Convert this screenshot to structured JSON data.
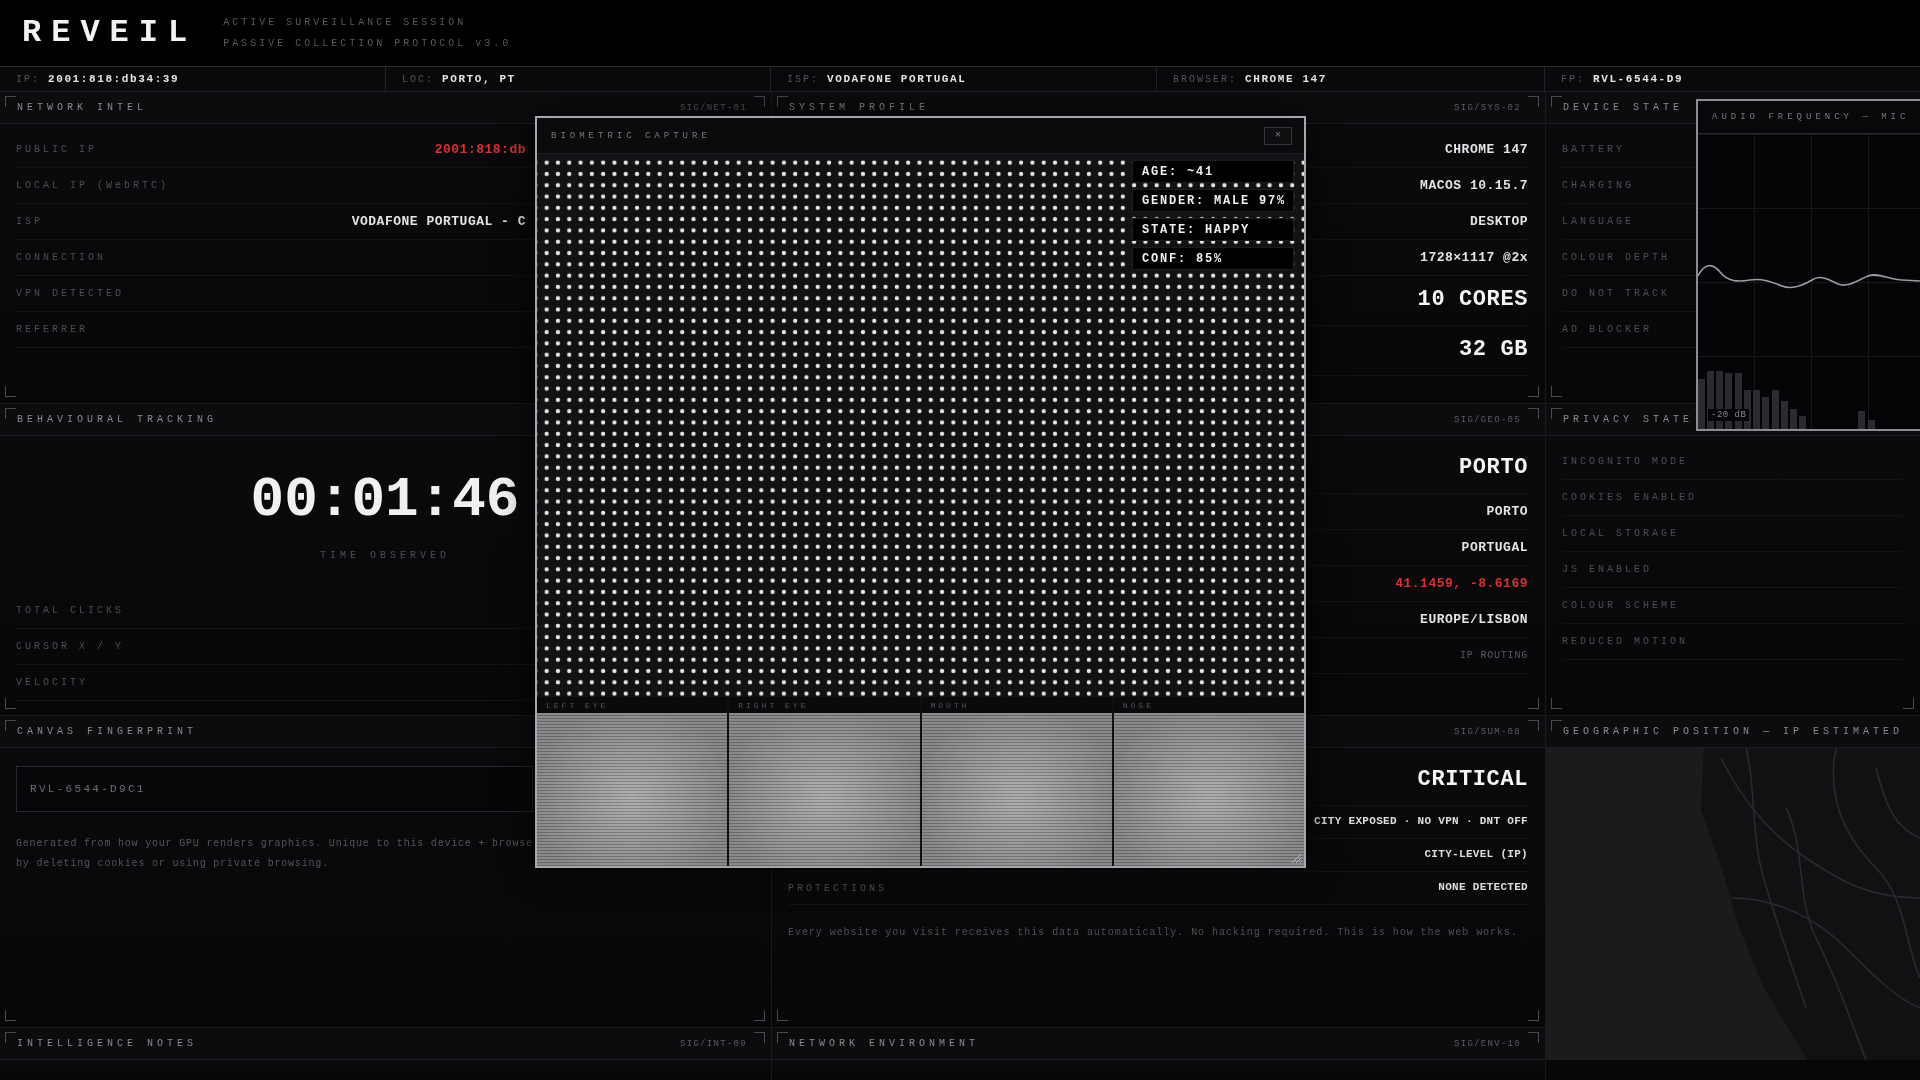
{
  "header": {
    "logo": "REVEIL",
    "subtitle_lines": [
      "ACTIVE SURVEILLANCE SESSION",
      "PASSIVE COLLECTION PROTOCOL v3.0"
    ]
  },
  "info_bar": [
    {
      "label": "IP:",
      "value": "2001:818:db34:39"
    },
    {
      "label": "LOC:",
      "value": "PORTO, PT"
    },
    {
      "label": "ISP:",
      "value": "VODAFONE PORTUGAL"
    },
    {
      "label": "BROWSER:",
      "value": "CHROME 147"
    },
    {
      "label": "FP:",
      "value": "RVL-6544-D9"
    }
  ],
  "panels": [
    {
      "kind": "rows",
      "title": "NETWORK INTEL",
      "code": "SIG/NET-01",
      "rows": [
        {
          "kind": "alert",
          "label": "PUBLIC IP",
          "value": "2001:818:db"
        },
        {
          "kind": "field",
          "label": "LOCAL IP (WebRTC)"
        },
        {
          "kind": "field",
          "label": "ISP",
          "value": "VODAFONE PORTUGAL - C"
        },
        {
          "kind": "field",
          "label": "CONNECTION"
        },
        {
          "kind": "field",
          "label": "VPN DETECTED"
        },
        {
          "kind": "field",
          "label": "REFERRER"
        }
      ]
    },
    {
      "kind": "rows",
      "title": "SYSTEM PROFILE",
      "code": "SIG/SYS-02",
      "rows": [
        {
          "kind": "field",
          "value": "CHROME 147"
        },
        {
          "kind": "field",
          "value": "MACOS 10.15.7"
        },
        {
          "kind": "field",
          "value": "DESKTOP"
        },
        {
          "kind": "field",
          "value": "1728×1117 @2x"
        },
        {
          "kind": "large",
          "value": "10 CORES"
        },
        {
          "kind": "large",
          "value": "32 GB"
        }
      ]
    },
    {
      "kind": "rows",
      "title": "DEVICE STATE",
      "rows": [
        {
          "kind": "field",
          "label": "BATTERY"
        },
        {
          "kind": "field",
          "label": "CHARGING"
        },
        {
          "kind": "field",
          "label": "LANGUAGE"
        },
        {
          "kind": "field",
          "label": "COLOUR DEPTH"
        },
        {
          "kind": "field",
          "label": "DO NOT TRACK"
        },
        {
          "kind": "field",
          "label": "AD BLOCKER"
        }
      ]
    },
    {
      "kind": "timer",
      "title": "BEHAVIOURAL TRACKING",
      "timer": "00:01:46",
      "timer_label": "TIME OBSERVED",
      "rows": [
        {
          "kind": "field",
          "label": "TOTAL CLICKS"
        },
        {
          "kind": "field",
          "label": "CURSOR X / Y"
        },
        {
          "kind": "field",
          "label": "VELOCITY"
        }
      ]
    },
    {
      "kind": "rows",
      "code": "SIG/GEO-05",
      "rows": [
        {
          "kind": "large",
          "value": "PORTO"
        },
        {
          "kind": "field",
          "value": "PORTO"
        },
        {
          "kind": "field",
          "value": "PORTUGAL"
        },
        {
          "kind": "alert",
          "value": "41.1459, -8.6169"
        },
        {
          "kind": "field",
          "value": "EUROPE/LISBON"
        },
        {
          "kind": "muted",
          "value": "IP ROUTING"
        }
      ]
    },
    {
      "kind": "rows",
      "title": "PRIVACY STATE",
      "rows": [
        {
          "kind": "field",
          "label": "INCOGNITO MODE"
        },
        {
          "kind": "field",
          "label": "COOKIES ENABLED"
        },
        {
          "kind": "field",
          "label": "LOCAL STORAGE"
        },
        {
          "kind": "field",
          "label": "JS ENABLED"
        },
        {
          "kind": "field",
          "label": "COLOUR SCHEME"
        },
        {
          "kind": "field",
          "label": "REDUCED MOTION"
        }
      ]
    },
    {
      "kind": "fingerprint",
      "title": "CANVAS FINGERPRINT",
      "fingerprint": "RVL-6544-D9C1",
      "description_lines": [
        "Generated from how your GPU renders graphics. Unique to this device + browse",
        "by deleting cookies or using private browsing."
      ]
    },
    {
      "kind": "summary",
      "code": "SIG/SUM-08",
      "rows": [
        {
          "kind": "large",
          "value": "CRITICAL"
        },
        {
          "kind": "compact",
          "value": "CITY EXPOSED · NO VPN · DNT OFF"
        },
        {
          "kind": "compact",
          "value": "CITY-LEVEL (IP)"
        },
        {
          "kind": "compact",
          "label": "PROTECTIONS",
          "value": "NONE DETECTED"
        }
      ],
      "note": "Every website you visit receives this data automatically. No hacking required. This is how the web works."
    },
    {
      "kind": "map",
      "title": "GEOGRAPHIC POSITION — IP ESTIMATED"
    },
    {
      "kind": "rows",
      "title": "INTELLIGENCE NOTES",
      "code": "SIG/INT-09"
    },
    {
      "kind": "rows",
      "title": "NETWORK ENVIRONMENT",
      "code": "SIG/ENV-10"
    }
  ],
  "audio_monitor": {
    "title": "AUDIO FREQUENCY — MIC",
    "scale_label": "-20 dB"
  },
  "biometric_capture": {
    "title": "BIOMETRIC CAPTURE",
    "close_label": "×",
    "tags": [
      "AGE: ~41",
      "GENDER: MALE 97%",
      "STATE: HAPPY",
      "CONF: 85%"
    ],
    "crops": [
      "LEFT EYE",
      "RIGHT EYE",
      "MOUTH",
      "NOSE"
    ]
  }
}
